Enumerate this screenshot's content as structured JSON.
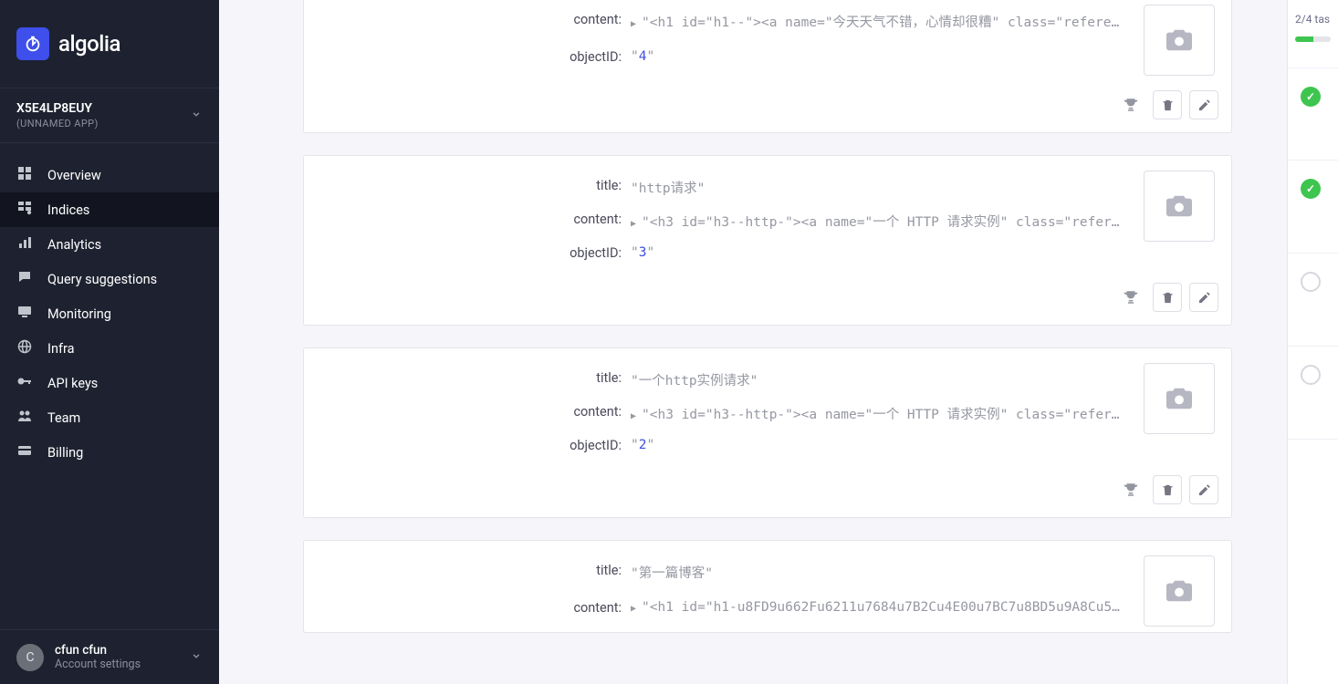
{
  "brand": "algolia",
  "app": {
    "id": "X5E4LP8EUY",
    "label": "(UNNAMED APP)"
  },
  "nav": [
    {
      "key": "overview",
      "label": "Overview",
      "icon": "dashboard"
    },
    {
      "key": "indices",
      "label": "Indices",
      "icon": "indices"
    },
    {
      "key": "analytics",
      "label": "Analytics",
      "icon": "chart"
    },
    {
      "key": "query",
      "label": "Query suggestions",
      "icon": "comment"
    },
    {
      "key": "monitoring",
      "label": "Monitoring",
      "icon": "monitor"
    },
    {
      "key": "infra",
      "label": "Infra",
      "icon": "globe"
    },
    {
      "key": "apikeys",
      "label": "API keys",
      "icon": "key"
    },
    {
      "key": "team",
      "label": "Team",
      "icon": "users"
    },
    {
      "key": "billing",
      "label": "Billing",
      "icon": "card"
    }
  ],
  "active_nav": "indices",
  "user": {
    "initial": "C",
    "name": "cfun cfun",
    "sub": "Account settings"
  },
  "field_labels": {
    "title": "title:",
    "content": "content:",
    "objectID": "objectID:"
  },
  "records": [
    {
      "content": "\"<h1 id=\"h1--\"><a name=\"今天天气不错，心情却很糟\" class=\"reference-link\">…",
      "objectID": "4"
    },
    {
      "title": "\"http请求\"",
      "content": "\"<h3 id=\"h3--http-\"><a name=\"一个 HTTP 请求实例\" class=\"reference-link\"><…",
      "objectID": "3"
    },
    {
      "title": "\"一个http实例请求\"",
      "content": "\"<h3 id=\"h3--http-\"><a name=\"一个 HTTP 请求实例\" class=\"reference-link\"><…",
      "objectID": "2"
    },
    {
      "title": "\"第一篇博客\"",
      "content": "\"<h1 id=\"h1-u8FD9u662Fu6211u7684u7B2Cu4E00u7BC7u8BD5u9A8Cu535…"
    }
  ],
  "tasks": {
    "label": "2/4 tas",
    "done": 2,
    "total": 4,
    "items": [
      true,
      true,
      false,
      false
    ]
  }
}
